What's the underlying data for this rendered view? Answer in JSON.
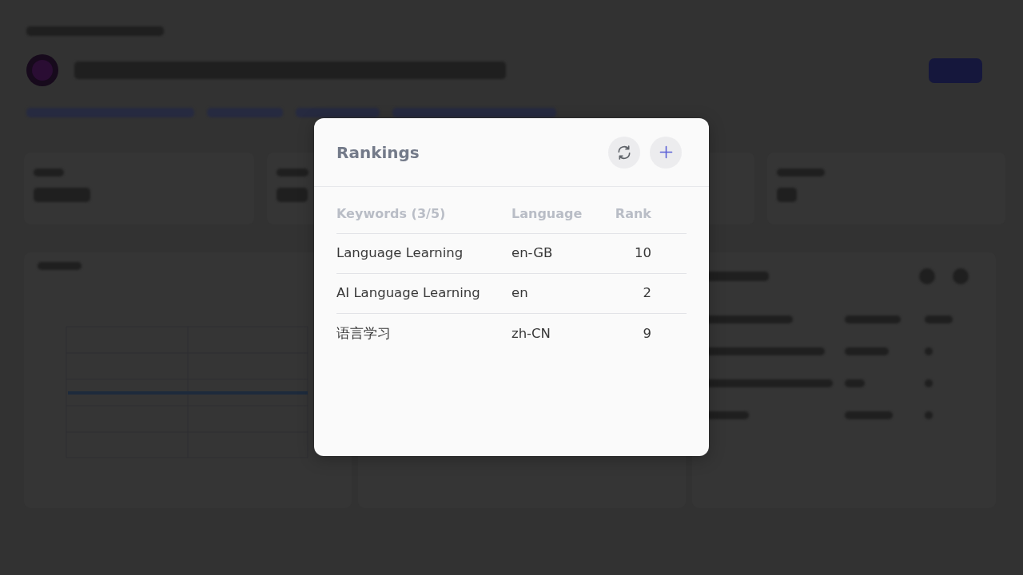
{
  "dialog": {
    "title": "Rankings",
    "columns": [
      "Keywords (3/5)",
      "Language",
      "Rank"
    ],
    "rows": [
      [
        "Language Learning",
        "en-GB",
        "10"
      ],
      [
        "AI Language Learning",
        "en",
        "2"
      ],
      [
        "语言学习",
        "zh-CN",
        "9"
      ]
    ]
  }
}
